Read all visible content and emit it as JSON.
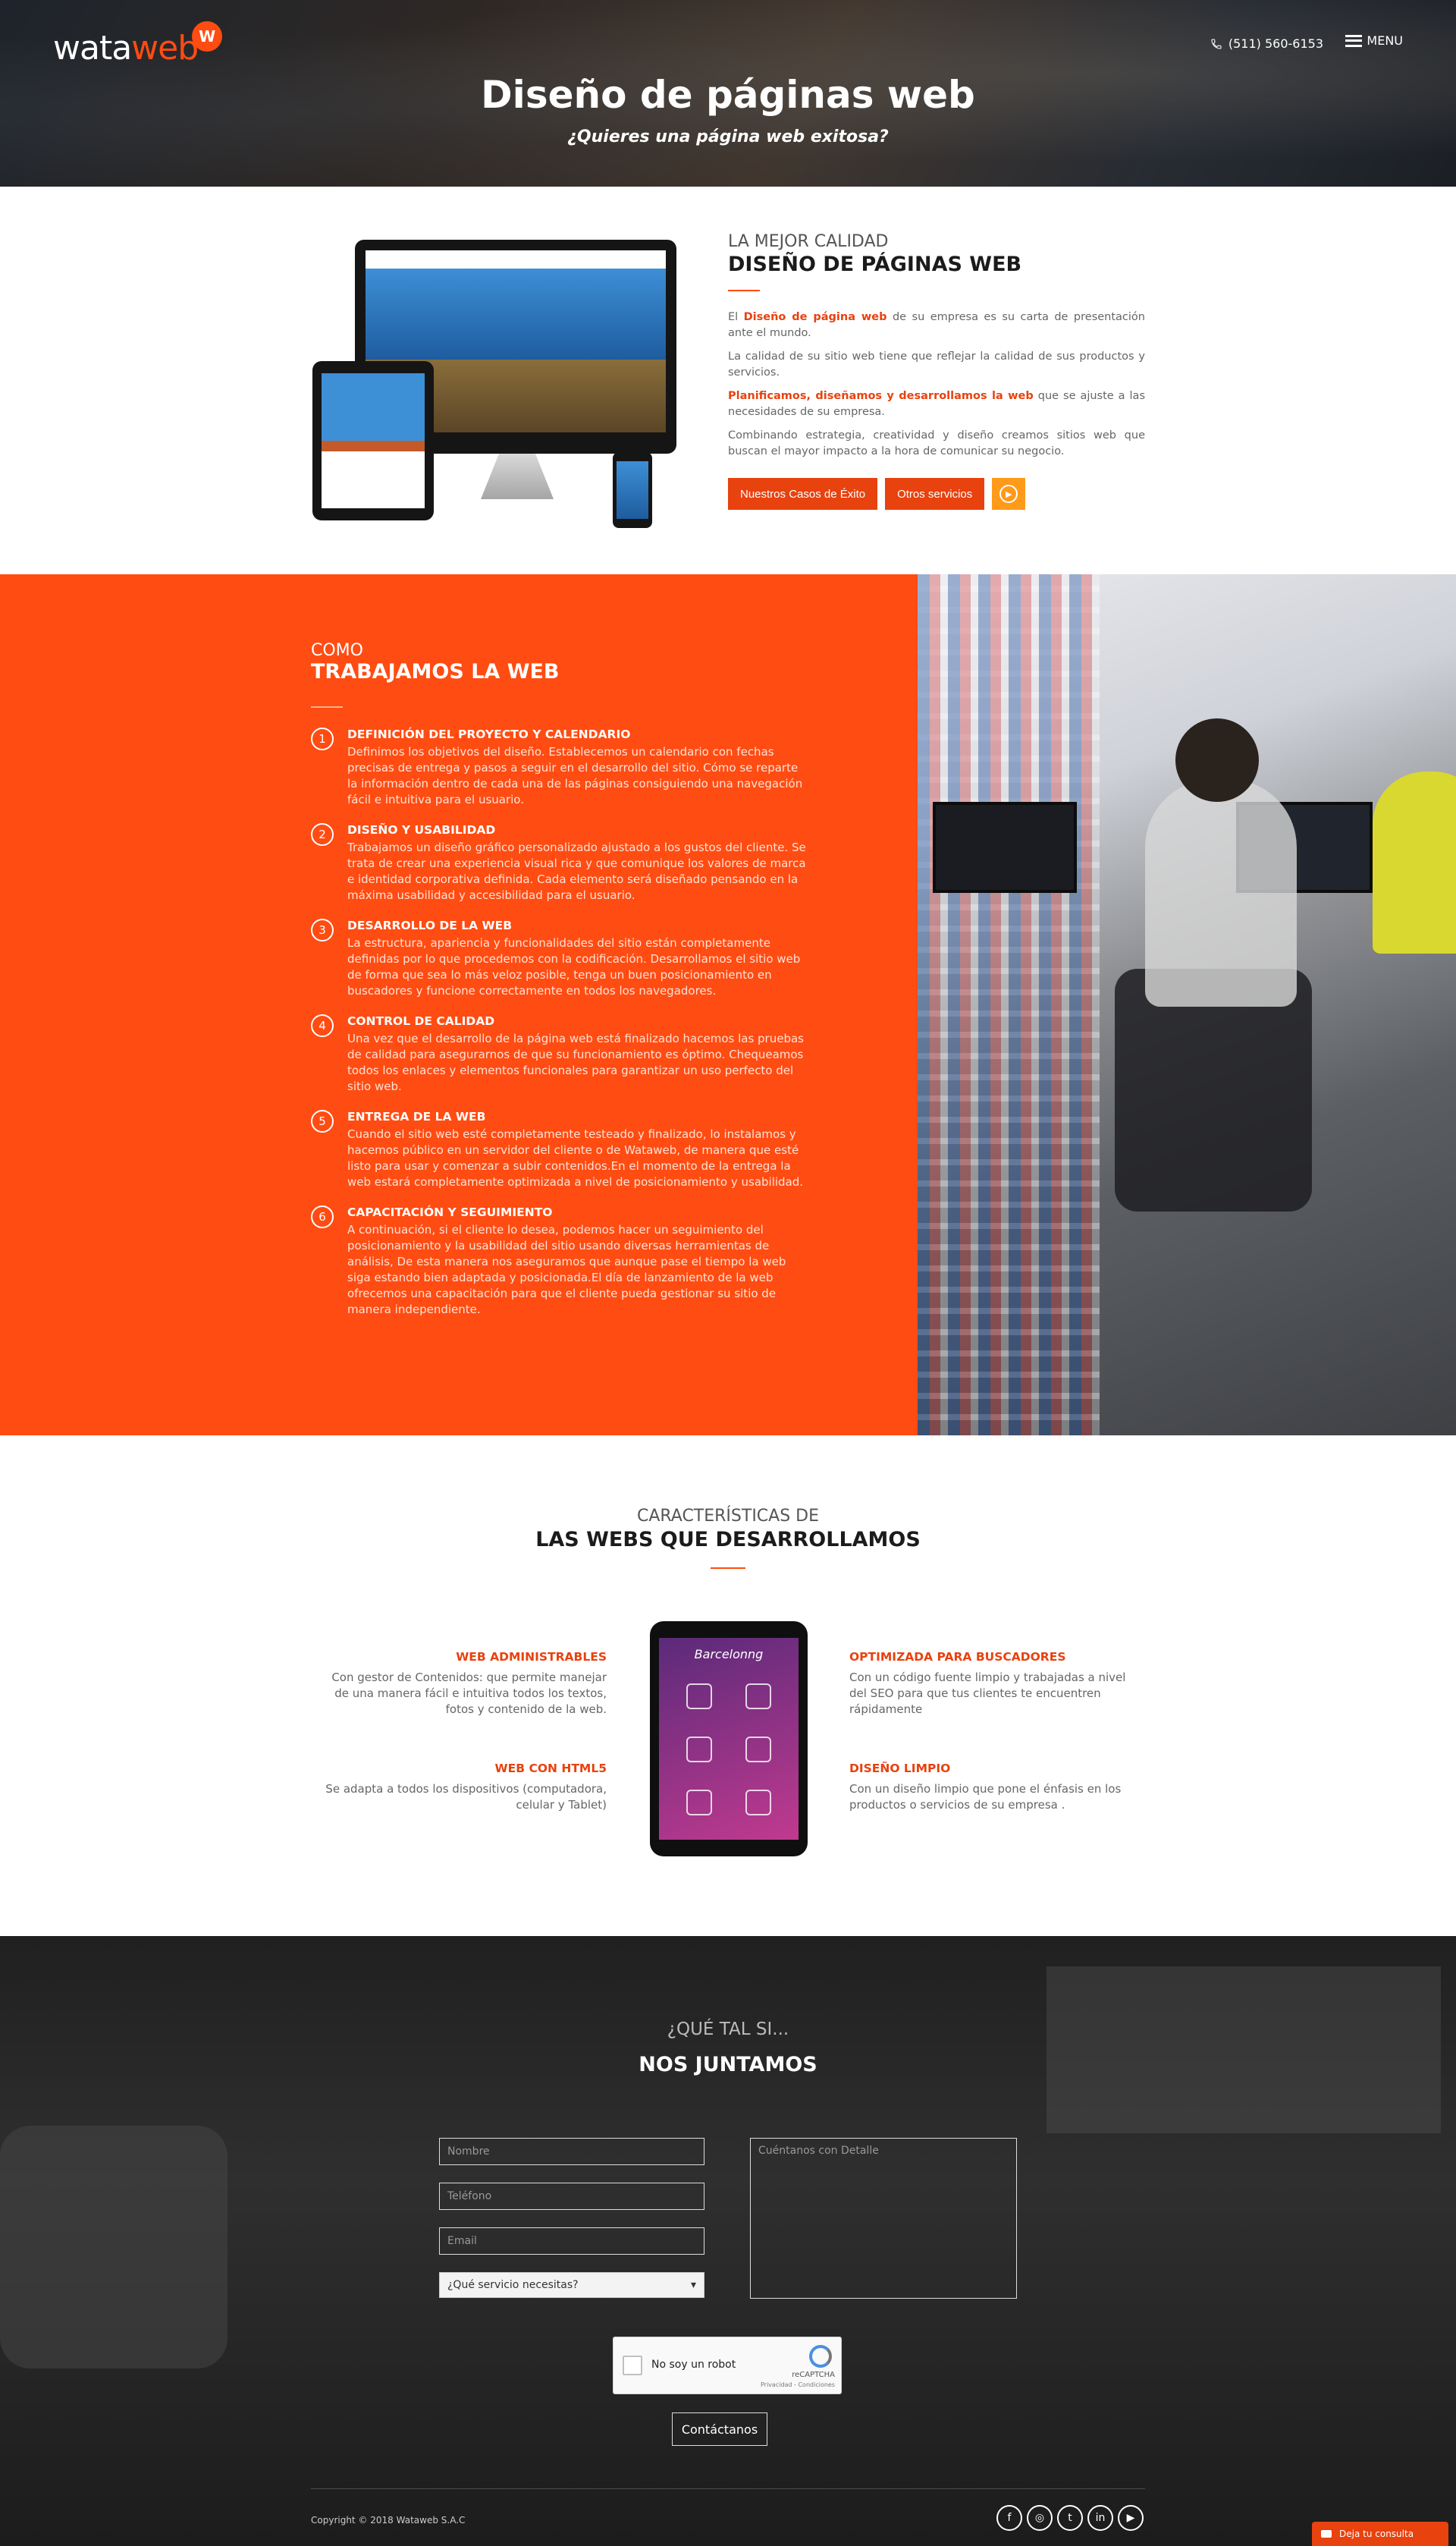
{
  "colors": {
    "accent": "#ff4c12",
    "accent_dark": "#e8420f",
    "orange_button": "#ff9a1a"
  },
  "header": {
    "logo_wata": "wata",
    "logo_web": "web",
    "logo_mark": "W",
    "phone": "(511) 560-6153",
    "menu_label": "MENU",
    "title": "Diseño de páginas web",
    "subtitle": "¿Quieres una página web exitosa?"
  },
  "intro": {
    "eyebrow": "LA MEJOR CALIDAD",
    "heading": "DISEÑO DE PÁGINAS WEB",
    "p1_pre": "El ",
    "p1_hl": "Diseño de página web",
    "p1_post": " de su empresa es su carta de presentación ante el mundo.",
    "p2": "La calidad de su sitio web tiene que reflejar la calidad de sus productos y servicios.",
    "p3_hl": "Planificamos, diseñamos y desarrollamos la web",
    "p3_post": " que se ajuste a las necesidades de su empresa.",
    "p4": "Combinando estrategia, creatividad y diseño creamos sitios web que buscan el mayor impacto a la hora de comunicar su negocio.",
    "btn_cases": "Nuestros Casos de Éxito",
    "btn_services": "Otros servicios",
    "play_icon": "play-icon"
  },
  "process": {
    "eyebrow": "COMO",
    "heading": "TRABAJAMOS LA WEB",
    "steps": [
      {
        "num": "1",
        "title": "DEFINICIÓN DEL PROYECTO Y CALENDARIO",
        "text": "Definimos los objetivos del diseño. Establecemos un calendario con fechas precisas de entrega y pasos a seguir en el desarrollo del sitio. Cómo se reparte la información dentro de cada una de las páginas consiguiendo una navegación fácil e intuitiva para el usuario."
      },
      {
        "num": "2",
        "title": "DISEÑO Y USABILIDAD",
        "text": "Trabajamos un diseño gráfico personalizado ajustado a los gustos del cliente. Se trata de crear una experiencia visual rica y que comunique los valores de marca e identidad corporativa definida. Cada elemento será diseñado pensando en la máxima usabilidad y accesibilidad para el usuario."
      },
      {
        "num": "3",
        "title": "DESARROLLO DE LA WEB",
        "text": "La estructura, apariencia y funcionalidades del sitio están completamente definidas por lo que procedemos con la codificación. Desarrollamos el sitio web de forma que sea lo más veloz posible, tenga un buen posicionamiento en buscadores y funcione correctamente en todos los navegadores."
      },
      {
        "num": "4",
        "title": "CONTROL DE CALIDAD",
        "text": "Una vez que el desarrollo de la página web está finalizado hacemos las pruebas de calidad para asegurarnos de que su funcionamiento es óptimo. Chequeamos todos los enlaces y elementos funcionales para garantizar un uso perfecto del sitio web."
      },
      {
        "num": "5",
        "title": "ENTREGA DE LA WEB",
        "text": "Cuando el sitio web esté completamente testeado y finalizado, lo instalamos y hacemos público en un servidor del cliente o de Wataweb, de manera que esté listo para usar y comenzar a subir contenidos.En el momento de la entrega la web estará completamente optimizada a nivel de posicionamiento y usabilidad."
      },
      {
        "num": "6",
        "title": "CAPACITACIÓN Y SEGUIMIENTO",
        "text": "A continuación, si el cliente lo desea, podemos hacer un seguimiento del posicionamiento y la usabilidad del sitio usando diversas herramientas de análisis, De esta manera nos aseguramos que aunque pase el tiempo la web siga estando bien adaptada y posicionada.El día de lanzamiento de la web ofrecemos una capacitación para que el cliente pueda gestionar su sitio de manera independiente."
      }
    ]
  },
  "features": {
    "eyebrow": "CARACTERÍSTICAS DE",
    "heading": "LAS WEBS QUE DESARROLLAMOS",
    "items": [
      {
        "title": "WEB ADMINISTRABLES",
        "text": "Con gestor de Contenidos: que permite manejar de una manera fácil e intuitiva todos los textos, fotos y contenido de la web."
      },
      {
        "title": "OPTIMIZADA PARA BUSCADORES",
        "text": "Con un código fuente limpio y trabajadas a nivel del SEO para que tus clientes te encuentren rápidamente"
      },
      {
        "title": "WEB CON HTML5",
        "text": "Se adapta a todos los dispositivos (computadora, celular y Tablet)"
      },
      {
        "title": "DISEÑO LIMPIO",
        "text": "Con un diseño limpio que pone el énfasis en los productos o servicios de su empresa ."
      }
    ],
    "tablet_brand": "Barcelonng"
  },
  "contact": {
    "eyebrow": "¿QUÉ TAL SI...",
    "heading": "NOS JUNTAMOS",
    "name_placeholder": "Nombre",
    "phone_placeholder": "Teléfono",
    "email_placeholder": "Email",
    "service_select": "¿Qué servicio necesitas?",
    "message_placeholder": "Cuéntanos con Detalle",
    "captcha_label": "No soy un robot",
    "captcha_brand": "reCAPTCHA",
    "captcha_privacy": "Privacidad - Condiciones",
    "submit": "Contáctanos"
  },
  "footer": {
    "copyright": "Copyright © 2018 Wataweb S.A.C",
    "socials": [
      "facebook-icon",
      "instagram-icon",
      "twitter-icon",
      "linkedin-icon",
      "youtube-icon"
    ],
    "social_glyphs": [
      "f",
      "◎",
      "t",
      "in",
      "▶"
    ],
    "chat_label": "Deja tu consulta"
  }
}
